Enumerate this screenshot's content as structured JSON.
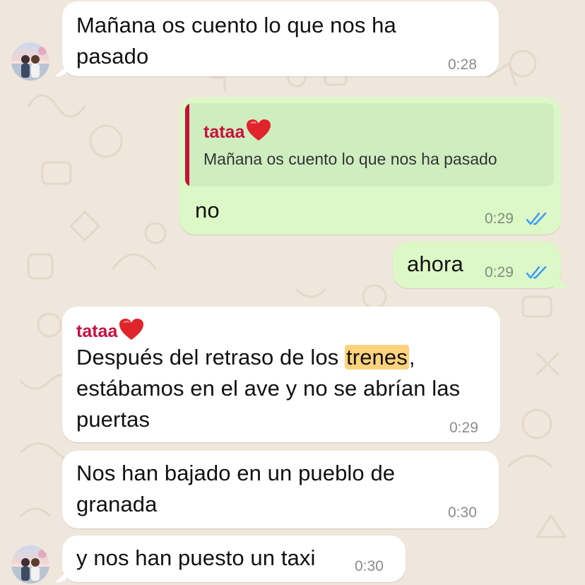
{
  "chat": {
    "colors": {
      "background": "#efe7dc",
      "incoming_bubble": "#ffffff",
      "outgoing_bubble": "#dcf8c6",
      "sender_name": "#c8103e",
      "read_ticks": "#3497f9",
      "search_highlight": "#ffd37d"
    },
    "messages": [
      {
        "direction": "incoming",
        "text": "Mañana os cuento lo que nos ha\npasado",
        "time": "0:28"
      },
      {
        "direction": "outgoing",
        "quoted_sender": "tataa",
        "quoted_sender_emoji": "heart-icon",
        "quoted_text": "Mañana os cuento lo que nos ha pasado",
        "text": "no",
        "time": "0:29",
        "status": "read-double-check"
      },
      {
        "direction": "outgoing",
        "text": "ahora",
        "time": "0:29",
        "status": "read-double-check"
      },
      {
        "direction": "incoming",
        "sender": "tataa",
        "sender_emoji": "heart-icon",
        "text_before_highlight": "Después del retraso de los ",
        "highlighted_word": "trenes",
        "text_after_highlight": ",\nestábamos en el ave y no se abrían las\npuertas",
        "time": "0:29"
      },
      {
        "direction": "incoming",
        "text": "Nos han bajado en un pueblo de\ngranada",
        "time": "0:30"
      },
      {
        "direction": "incoming",
        "text": "y nos han puesto un taxi",
        "time": "0:30"
      }
    ]
  }
}
